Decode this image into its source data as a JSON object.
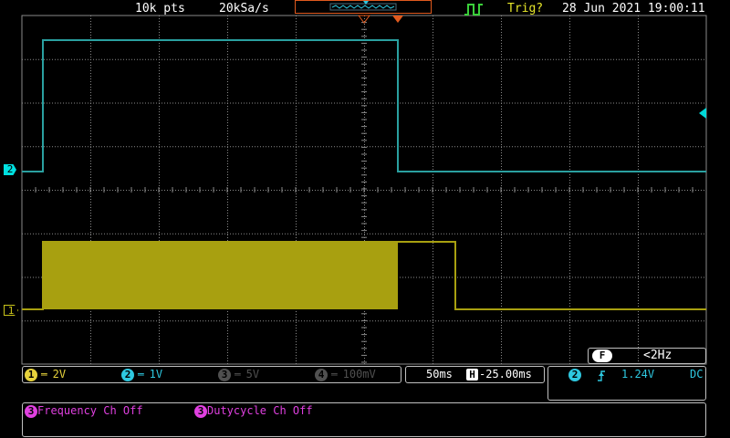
{
  "header": {
    "record_length": "10k pts",
    "sample_rate": "20kSa/s",
    "trigger_status": "Trig?",
    "datetime": "28 Jun 2021 19:00:11"
  },
  "channels": [
    {
      "id": "1",
      "scale": "2V",
      "coupling": "DC",
      "active": true,
      "color": "#e6d23c"
    },
    {
      "id": "2",
      "scale": "1V",
      "coupling": "DC",
      "active": true,
      "color": "#2ec8e0"
    },
    {
      "id": "3",
      "scale": "5V",
      "coupling": "DC",
      "active": false,
      "color": "#505050"
    },
    {
      "id": "4",
      "scale": "100mV",
      "coupling": "DC",
      "active": false,
      "color": "#505050"
    }
  ],
  "timebase": {
    "scale": "50ms",
    "position": "-25.00ms",
    "position_icon": "H"
  },
  "trigger": {
    "source": "2",
    "slope": "rising",
    "level": "1.24V",
    "coupling": "DC"
  },
  "frequency_counter": {
    "label": "F",
    "value": "<2Hz"
  },
  "measurements": [
    {
      "channel": "3",
      "text": "Frequency Ch Off"
    },
    {
      "channel": "3",
      "text": "Dutycycle Ch Off"
    }
  ],
  "markers": {
    "ch1": "1",
    "ch2": "2"
  },
  "colors": {
    "ch1_trace": "#a8a010",
    "ch2_trace": "#2aa0a0",
    "grid": "#8a8a8a",
    "trigger_accent": "#e05a1e",
    "measurement_text": "#e040e0"
  }
}
